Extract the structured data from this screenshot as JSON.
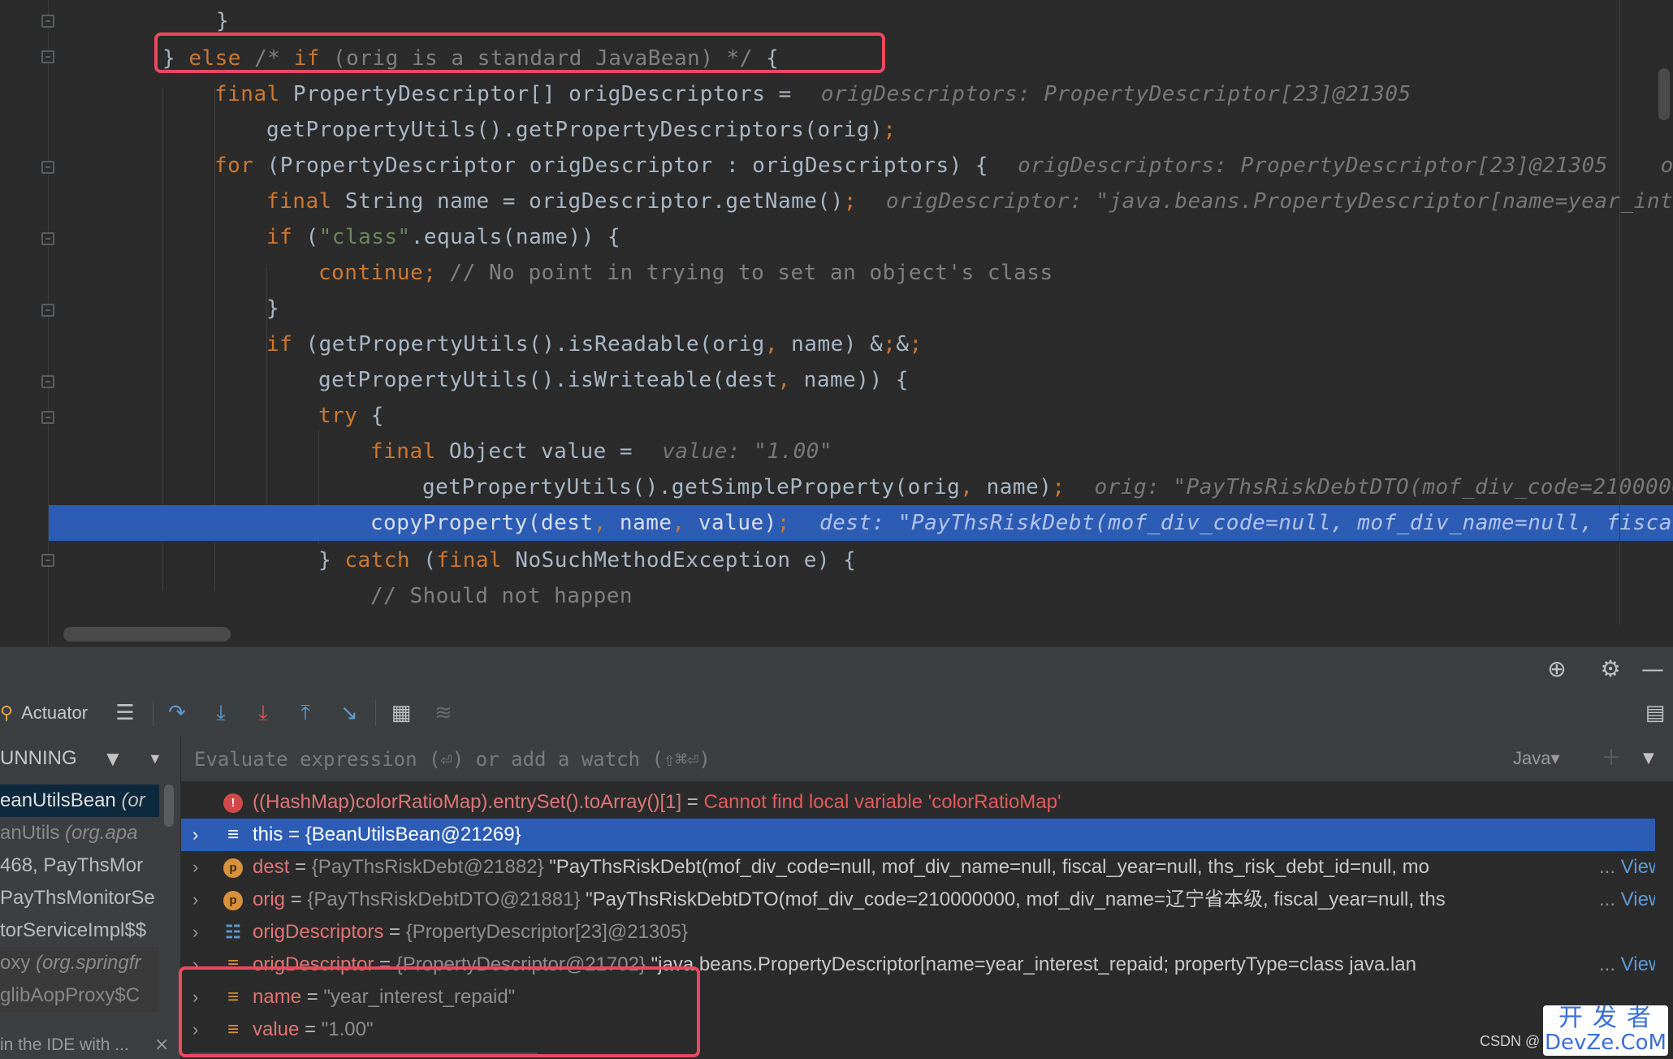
{
  "code": {
    "lines": [
      "}",
      "} else /* if (orig is a standard JavaBean) */ {",
      "final PropertyDescriptor[] origDescriptors =",
      "getPropertyUtils().getPropertyDescriptors(orig);",
      "for (PropertyDescriptor origDescriptor : origDescriptors) {",
      "final String name = origDescriptor.getName();",
      "if (\"class\".equals(name)) {",
      "continue; // No point in trying to set an object's class",
      "}",
      "if (getPropertyUtils().isReadable(orig, name) &&",
      "getPropertyUtils().isWriteable(dest, name)) {",
      "try {",
      "final Object value =",
      "getPropertyUtils().getSimpleProperty(orig, name);",
      "copyProperty(dest, name, value);",
      "} catch (final NoSuchMethodException e) {",
      "// Should not happen"
    ],
    "hints": {
      "origDescriptors": "origDescriptors: PropertyDescriptor[23]@21305",
      "for_loop": "origDescriptors: PropertyDescriptor[23]@21305    or",
      "name": "origDescriptor: \"java.beans.PropertyDescriptor[name=year_inte",
      "value": "value: \"1.00\"",
      "orig": "orig: \"PayThsRiskDebtDTO(mof_div_code=2100000",
      "dest": "dest: \"PayThsRiskDebt(mof_div_code=null, mof_div_name=null, fiscal"
    }
  },
  "toolbar": {
    "actuator_label": "Actuator"
  },
  "frames": {
    "status": "UNNING",
    "rows": [
      {
        "name": "eanUtilsBean",
        "pkg": "(or"
      },
      {
        "name": "anUtils",
        "pkg": "(org.apa"
      },
      {
        "name": "468, PayThsMor",
        "pkg": ""
      },
      {
        "name": "PayThsMonitorSe",
        "pkg": ""
      },
      {
        "name": "torServiceImpl$$",
        "pkg": ""
      },
      {
        "name": "oxy",
        "pkg": "(org.springfr"
      },
      {
        "name": "glibAopProxy$C",
        "pkg": ""
      }
    ],
    "footer": "in the IDE with ..."
  },
  "evaluate": {
    "placeholder": "Evaluate expression (⏎) or add a watch (⇧⌘⏎)",
    "language": "Java"
  },
  "variables": {
    "watch": {
      "expr": "((HashMap)colorRatioMap).entrySet().toArray()[1]",
      "eq": " = ",
      "error": "Cannot find local variable 'colorRatioMap'"
    },
    "this": {
      "name": "this",
      "eq": " = ",
      "value": "{BeanUtilsBean@21269}"
    },
    "dest": {
      "name": "dest",
      "eq": " = ",
      "type": "{PayThsRiskDebt@21882}",
      "desc": " \"PayThsRiskDebt(mof_div_code=null, mof_div_name=null, fiscal_year=null, ths_risk_debt_id=null, mo",
      "view": "View"
    },
    "orig": {
      "name": "orig",
      "eq": " = ",
      "type": "{PayThsRiskDebtDTO@21881}",
      "desc": " \"PayThsRiskDebtDTO(mof_div_code=210000000, mof_div_name=辽宁省本级, fiscal_year=null, ths",
      "view": "View"
    },
    "origDescriptors": {
      "name": "origDescriptors",
      "eq": " = ",
      "type": "{PropertyDescriptor[23]@21305}"
    },
    "origDescriptor": {
      "name": "origDescriptor",
      "eq": " = ",
      "type": "{PropertyDescriptor@21702}",
      "desc": " \"java.beans.PropertyDescriptor[name=year_interest_repaid; propertyType=class java.lan",
      "view": "View"
    },
    "name": {
      "name": "name",
      "eq": " = ",
      "value": "\"year_interest_repaid\""
    },
    "value": {
      "name": "value",
      "eq": " = ",
      "value": "\"1.00\""
    }
  },
  "watermarks": {
    "csdn": "CSDN @",
    "devze_cn": "开发者",
    "devze_en": "DevZe.CoM"
  },
  "colors": {
    "keyword": "#cc7832",
    "highlight": "#2d5cb5",
    "annotation_box": "#e84a5f"
  }
}
